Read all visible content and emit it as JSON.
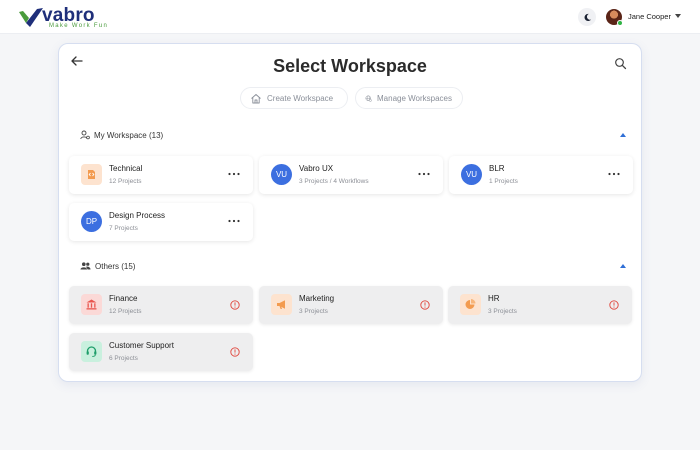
{
  "brand": {
    "name": "vabro",
    "tagline": "Make Work Fun",
    "colors": {
      "navy": "#1f2f7a",
      "green": "#4a9b3c",
      "accent": "#2f6fd6"
    }
  },
  "user": {
    "name": "Jane Cooper",
    "status_color": "#2fb344"
  },
  "panel": {
    "title": "Select Workspace",
    "actions": {
      "create_label": "Create Workspace",
      "manage_label": "Manage Workspaces"
    }
  },
  "sections": {
    "my": {
      "label": "My Workspace (13)",
      "cards": [
        {
          "name": "Technical",
          "sub": "12 Projects",
          "icon": "technical-icon",
          "icon_bg": "#fde3cf"
        },
        {
          "name": "Vabro UX",
          "sub": "3 Projects / 4 Workflows",
          "initials": "VU"
        },
        {
          "name": "BLR",
          "sub": "1 Projects",
          "initials": "VU"
        },
        {
          "name": "Design Process",
          "sub": "7 Projects",
          "initials": "DP"
        }
      ]
    },
    "others": {
      "label": "Others (15)",
      "cards": [
        {
          "name": "Finance",
          "sub": "12 Projects",
          "icon": "bank-icon",
          "icon_bg": "#fbd9d7"
        },
        {
          "name": "Marketing",
          "sub": "3 Projects",
          "icon": "megaphone-icon",
          "icon_bg": "#fde3cf"
        },
        {
          "name": "HR",
          "sub": "3 Projects",
          "icon": "pie-chart-icon",
          "icon_bg": "#fde3cf"
        },
        {
          "name": "Customer Support",
          "sub": "6 Projects",
          "icon": "headset-icon",
          "icon_bg": "#c9f0de"
        }
      ]
    }
  }
}
